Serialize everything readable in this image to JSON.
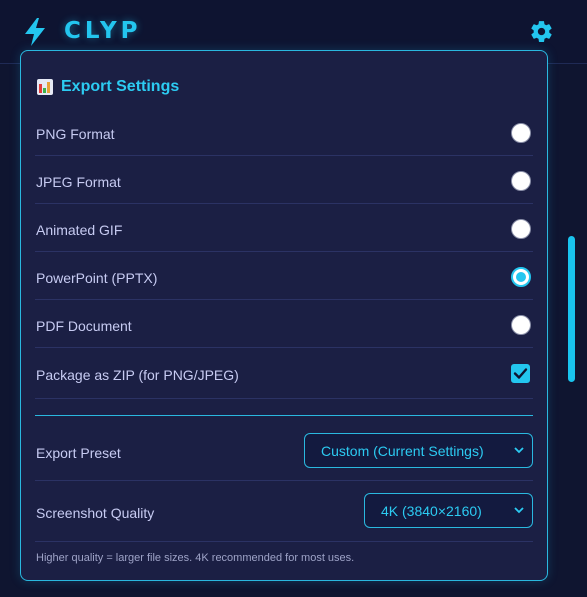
{
  "app": {
    "name": "CLYP",
    "logo_icon": "lightning-bolt-icon",
    "settings_icon": "gear-icon"
  },
  "colors": {
    "accent": "#23c6ef",
    "background": "#0f1530",
    "panel": "#1b1f44",
    "text": "#c7cbf2"
  },
  "export_settings": {
    "title": "Export Settings",
    "title_icon": "bar-chart-icon",
    "formats": [
      {
        "label": "PNG Format",
        "selected": false
      },
      {
        "label": "JPEG Format",
        "selected": false
      },
      {
        "label": "Animated GIF",
        "selected": false
      },
      {
        "label": "PowerPoint (PPTX)",
        "selected": true
      },
      {
        "label": "PDF Document",
        "selected": false
      }
    ],
    "zip_option": {
      "label": "Package as ZIP (for PNG/JPEG)",
      "checked": true
    },
    "preset": {
      "label": "Export Preset",
      "value": "Custom (Current Settings)"
    },
    "quality": {
      "label": "Screenshot Quality",
      "value": "4K (3840×2160)"
    },
    "hint": "Higher quality = larger file sizes. 4K recommended for most uses."
  }
}
